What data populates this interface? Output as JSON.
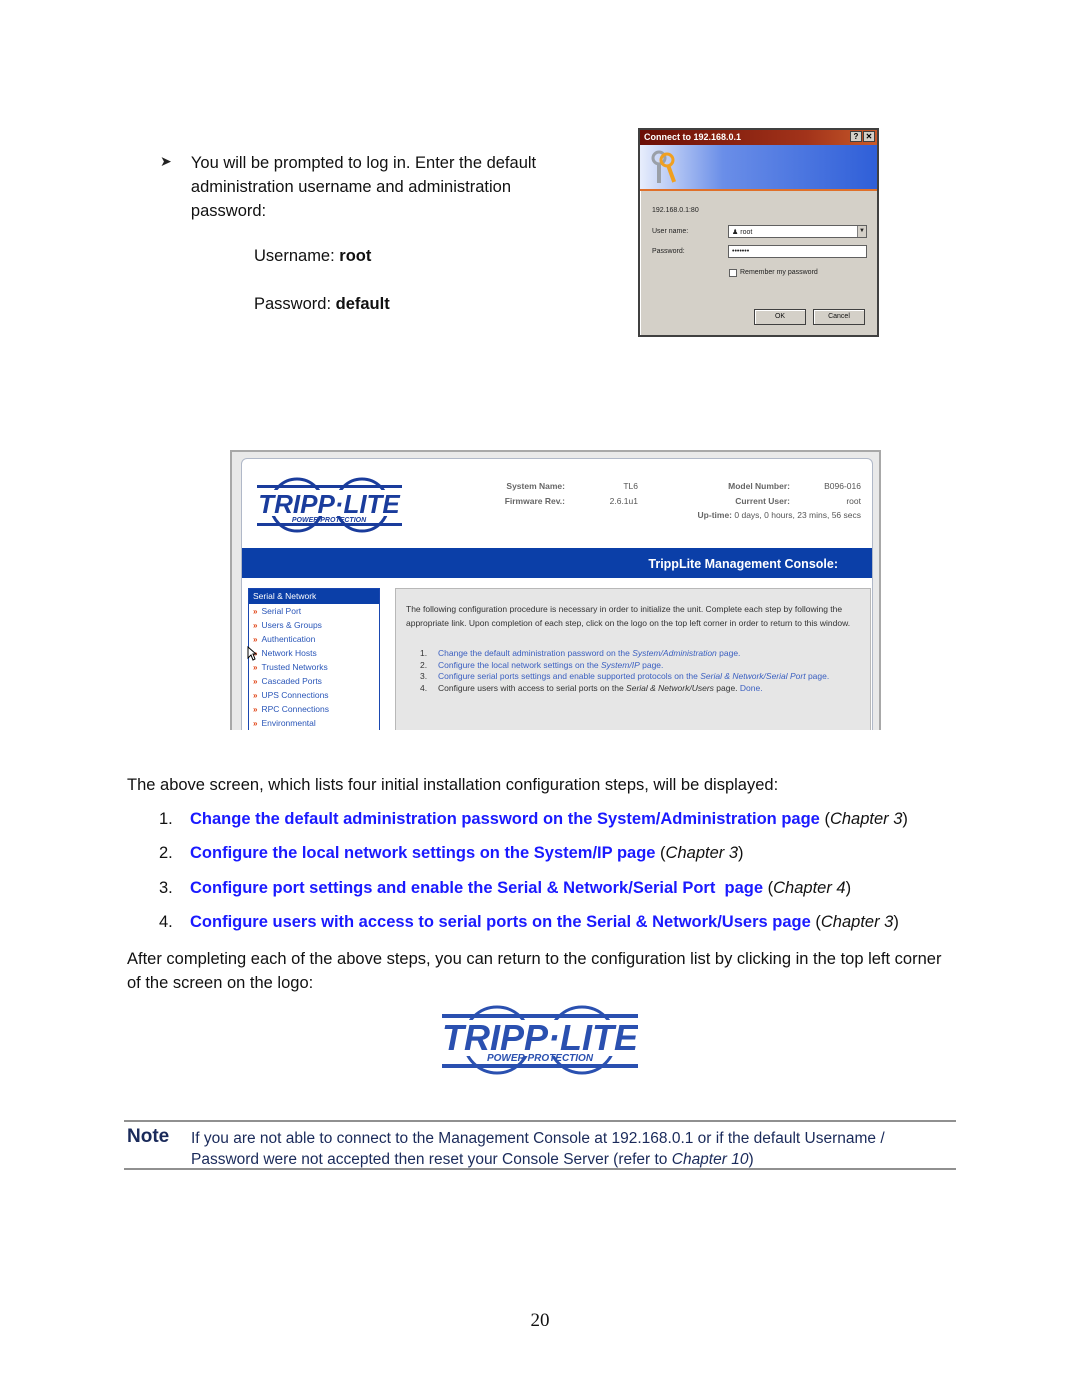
{
  "intro": {
    "bullet_icon": "arrow-bullet-icon",
    "paragraph": "You will be prompted to log in. Enter the default administration username and administration password:",
    "username_label": "Username: ",
    "username_value": "root",
    "password_label": "Password: ",
    "password_value": "default"
  },
  "login_dialog": {
    "title": "Connect to 192.168.0.1",
    "help_button": "?",
    "close_button": "✕",
    "host": "192.168.0.1:80",
    "username_label": "User name:",
    "username_value": "root",
    "password_label": "Password:",
    "password_masked": "•••••••",
    "remember_label": "Remember my password",
    "remember_checked": false,
    "ok_label": "OK",
    "cancel_label": "Cancel"
  },
  "console": {
    "logo": {
      "main": "TRIPP·LITE",
      "sub": "POWER PROTECTION"
    },
    "system_name_label": "System Name:",
    "system_name_value": "TL6",
    "firmware_label": "Firmware Rev.:",
    "firmware_value": "2.6.1u1",
    "model_label": "Model Number:",
    "model_value": "B096-016",
    "user_label": "Current User:",
    "user_value": "root",
    "uptime_label": "Up-time:",
    "uptime_value": " 0 days, 0 hours, 23 mins, 56 secs",
    "banner_title": "TrippLite Management Console:",
    "sidenav": {
      "heading": "Serial & Network",
      "items": [
        "Serial Port",
        "Users & Groups",
        "Authentication",
        "Network Hosts",
        "Trusted Networks",
        "Cascaded Ports",
        "UPS Connections",
        "RPC Connections",
        "Environmental"
      ]
    },
    "intro": "The following configuration procedure is necessary in order to initialize the unit. Complete each step by following the appropriate link. Upon completion of each step, click on the logo on the top left corner in order to return to this window.",
    "steps": [
      {
        "num": "1.",
        "pre": "Change the default administration password on the ",
        "em": "System/Administration",
        "post": " page."
      },
      {
        "num": "2.",
        "pre": "Configure the local network settings on the ",
        "em": "System/IP",
        "post": " page."
      },
      {
        "num": "3.",
        "pre": "Configure serial ports settings and enable supported protocols on the ",
        "em": "Serial & Network/Serial Port",
        "post": " page."
      },
      {
        "num": "4.",
        "pre": "Configure users with access to serial ports on the ",
        "em": "Serial & Network/Users",
        "post": " page. ",
        "done": "Done."
      }
    ]
  },
  "lead": "The above screen, which lists four initial installation configuration steps, will be displayed:",
  "steps": [
    {
      "num": "1.",
      "link": "Change the default administration password on the System/Administration page",
      "chapter": "Chapter 3"
    },
    {
      "num": "2.",
      "link": "Configure the local network settings on the System/IP page",
      "chapter": "Chapter 3"
    },
    {
      "num": "3.",
      "link": "Configure port settings and enable the Serial & Network/Serial Port  page",
      "chapter": "Chapter 4"
    },
    {
      "num": "4.",
      "link": "Configure users with access to serial ports on the Serial & Network/Users page",
      "chapter": "Chapter 3"
    }
  ],
  "after": "After completing each of the above steps, you can return to the configuration list by clicking in the top left corner of the screen on the logo:",
  "footer_logo": {
    "main": "TRIPP·LITE",
    "sub": "POWER PROTECTION"
  },
  "note": {
    "label": "Note",
    "text_pre": "If you are not able to connect to the Management Console at 192.168.0.1 or if the default Username / Password were not accepted then reset your Console Server (refer to ",
    "text_em": "Chapter 10",
    "text_post": ")"
  },
  "page_number": "20",
  "colors": {
    "link_blue": "#1a1aff",
    "console_blue": "#0b3fa8",
    "tripplite_blue": "#1a3c9c",
    "nav_bullet": "#e04010"
  }
}
